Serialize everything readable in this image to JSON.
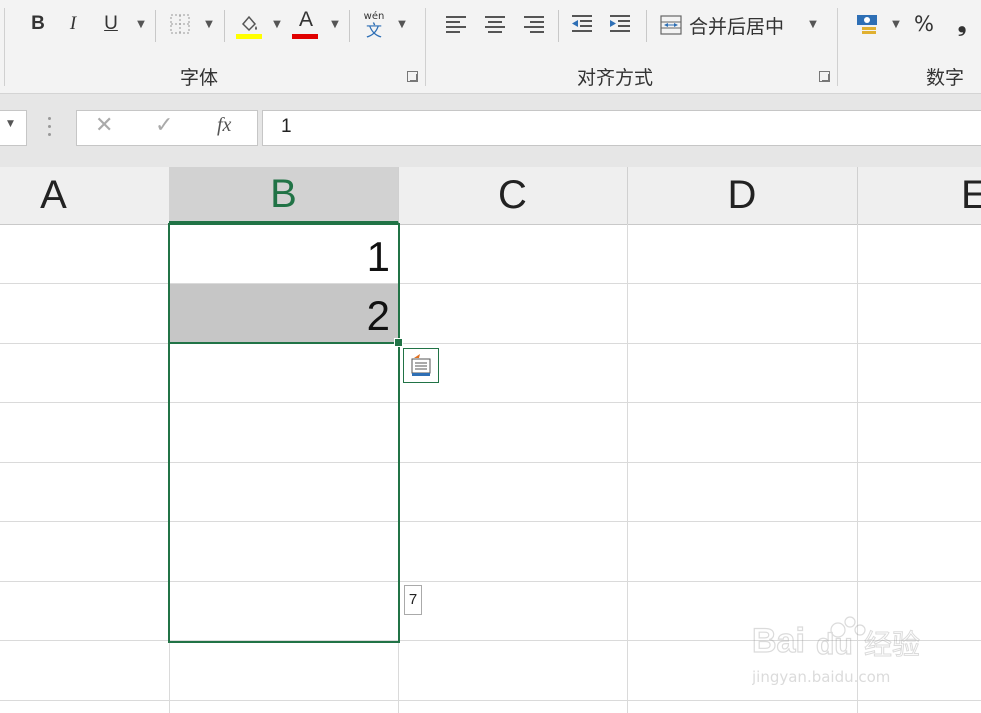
{
  "ribbon": {
    "font_group": {
      "label": "字体",
      "bold": "B",
      "italic": "I",
      "underline": "U",
      "font_color_glyph": "A",
      "phonetic_top": "wén",
      "phonetic_bottom": "文",
      "fill_color": "#ffff00",
      "font_color": "#e00000"
    },
    "align_group": {
      "label": "对齐方式",
      "merge_center": "合并后居中"
    },
    "number_group": {
      "label": "数字",
      "percent": "%",
      "comma": "❟"
    }
  },
  "formula_bar": {
    "cancel_icon": "✕",
    "enter_icon": "✓",
    "fx_label": "fx",
    "value": "1"
  },
  "columns": [
    "A",
    "B",
    "C",
    "D",
    "E"
  ],
  "cells": {
    "B1": "1",
    "B2": "2"
  },
  "fill_tooltip": "7",
  "colors": {
    "selection": "#217346",
    "selected_header": "#d2d2d2",
    "highlight_cell": "#c6c6c6"
  }
}
